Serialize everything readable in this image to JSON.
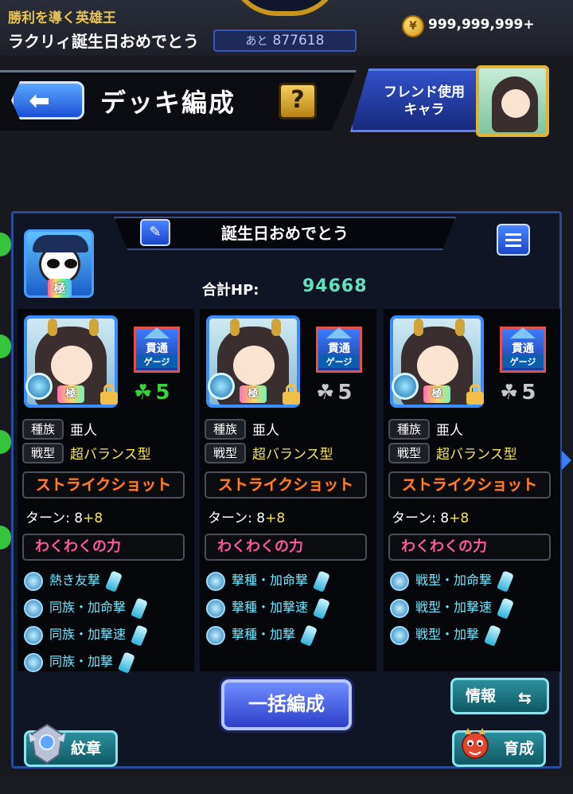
{
  "top": {
    "quest_title": "勝利を導く英雄王",
    "quest_sub": "ラクリィ誕生日おめでとう",
    "countdown_label": "あと",
    "countdown_value": "877618",
    "coin_icon": "coin-icon",
    "coins": "999,999,999+"
  },
  "header": {
    "title": "デッキ編成",
    "help": "?",
    "friend_line1": "フレンド使用",
    "friend_line2": "キャラ"
  },
  "deck": {
    "name": "誕生日おめでとう",
    "leader_badge": "極",
    "hp_label": "合計HP:",
    "hp_value": "94668"
  },
  "characters": [
    {
      "badge": "極",
      "gimmick_top": "貫通",
      "gimmick_bottom": "ゲージ",
      "luck": "5",
      "luck_color": "#38d33c",
      "tribe_label": "種族",
      "tribe": "亜人",
      "type_label": "戦型",
      "type": "超バランス型",
      "strike_shot": "ストライクショット",
      "turn_label": "ターン: 8",
      "turn_plus": "+8",
      "wakuwaku_title": "わくわくの力",
      "wakuwaku": [
        "熱き友撃",
        "同族・加命撃",
        "同族・加撃速",
        "同族・加撃"
      ]
    },
    {
      "badge": "極",
      "gimmick_top": "貫通",
      "gimmick_bottom": "ゲージ",
      "luck": "5",
      "luck_color": "#c9c9c9",
      "tribe_label": "種族",
      "tribe": "亜人",
      "type_label": "戦型",
      "type": "超バランス型",
      "strike_shot": "ストライクショット",
      "turn_label": "ターン: 8",
      "turn_plus": "+8",
      "wakuwaku_title": "わくわくの力",
      "wakuwaku": [
        "撃種・加命撃",
        "撃種・加撃速",
        "撃種・加撃"
      ]
    },
    {
      "badge": "極",
      "gimmick_top": "貫通",
      "gimmick_bottom": "ゲージ",
      "luck": "5",
      "luck_color": "#c9c9c9",
      "tribe_label": "種族",
      "tribe": "亜人",
      "type_label": "戦型",
      "type": "超バランス型",
      "strike_shot": "ストライクショット",
      "turn_label": "ターン: 8",
      "turn_plus": "+8",
      "wakuwaku_title": "わくわくの力",
      "wakuwaku": [
        "戦型・加命撃",
        "戦型・加撃速",
        "戦型・加撃"
      ]
    }
  ],
  "buttons": {
    "bulk": "一括編成",
    "info": "情報",
    "info_icon": "swap-arrows-icon",
    "crest": "紋章",
    "train": "育成"
  }
}
